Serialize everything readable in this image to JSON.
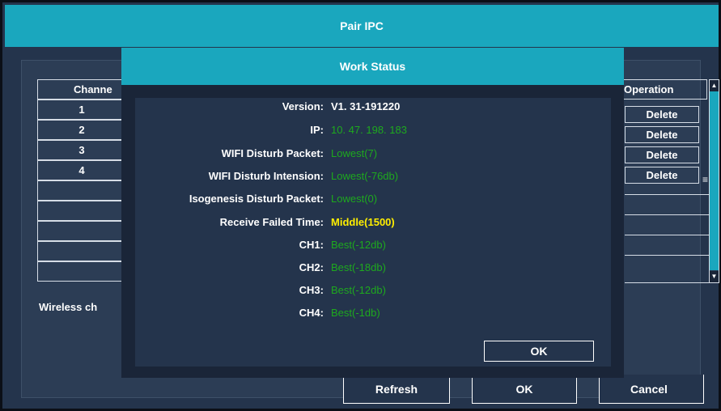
{
  "outer_window": {
    "title": "Pair IPC",
    "table": {
      "channel_header": "Channe",
      "operation_header": "Operation",
      "rows": [
        {
          "channel": "1",
          "operation": "Delete"
        },
        {
          "channel": "2",
          "operation": "Delete"
        },
        {
          "channel": "3",
          "operation": "Delete"
        },
        {
          "channel": "4",
          "operation": "Delete"
        }
      ]
    },
    "wireless_label": "Wireless ch",
    "buttons": {
      "refresh": "Refresh",
      "ok": "OK",
      "cancel": "Cancel"
    }
  },
  "work_status": {
    "title": "Work Status",
    "items": [
      {
        "label": "Version:",
        "value": "V1. 31-191220"
      },
      {
        "label": "IP:",
        "value": "10. 47. 198. 183"
      },
      {
        "label": "WIFI Disturb Packet:",
        "value": "Lowest(7)"
      },
      {
        "label": "WIFI Disturb Intension:",
        "value": "Lowest(-76db)"
      },
      {
        "label": "Isogenesis Disturb Packet:",
        "value": "Lowest(0)"
      },
      {
        "label": "Receive Failed Time:",
        "value": "Middle(1500)"
      },
      {
        "label": "CH1:",
        "value": "Best(-12db)"
      },
      {
        "label": "CH2:",
        "value": "Best(-18db)"
      },
      {
        "label": "CH3:",
        "value": "Best(-12db)"
      },
      {
        "label": "CH4:",
        "value": "Best(-1db)"
      }
    ],
    "ok_button": "OK"
  },
  "colors": {
    "title_bar": "#1aa7be",
    "value_good": "#1ea91e",
    "value_warn": "#ffee00"
  }
}
